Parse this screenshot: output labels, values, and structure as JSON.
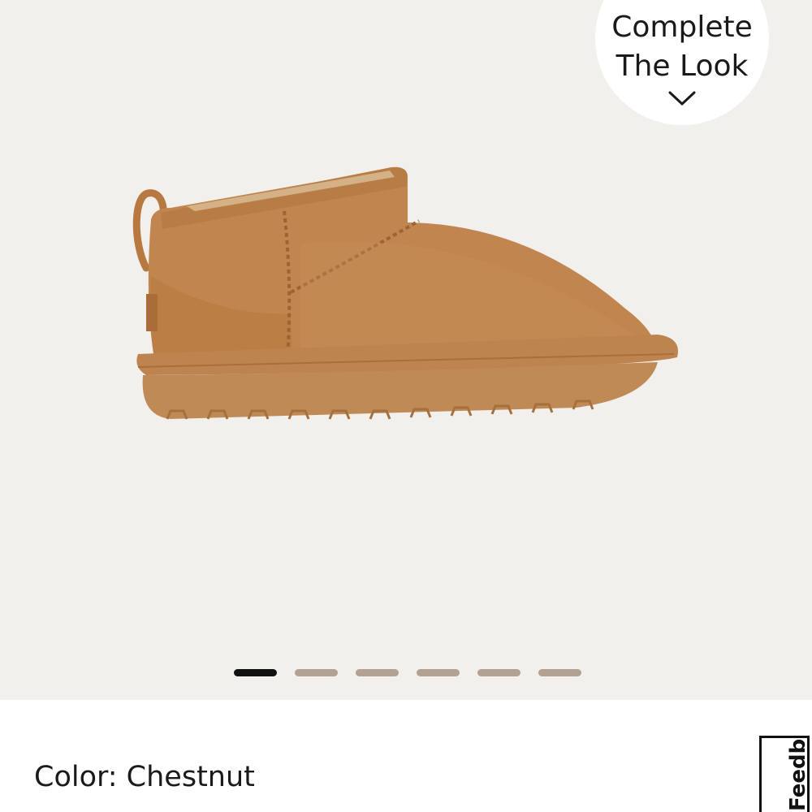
{
  "gallery": {
    "background_color": "#f2f0ec",
    "image": {
      "semantic": "chestnut suede ultra mini boot, side profile",
      "upper_color": "#c1864f",
      "sole_color": "#bd8450"
    },
    "complete_the_look": {
      "line1": "Complete",
      "line2": "The Look",
      "icon": "chevron-down-icon"
    },
    "pagination": {
      "total": 6,
      "active_index": 0,
      "active_color": "#111111",
      "inactive_color": "#b3a192"
    }
  },
  "product": {
    "color_label": "Color: Chestnut"
  },
  "feedback_tab": {
    "label": "Feedback"
  }
}
